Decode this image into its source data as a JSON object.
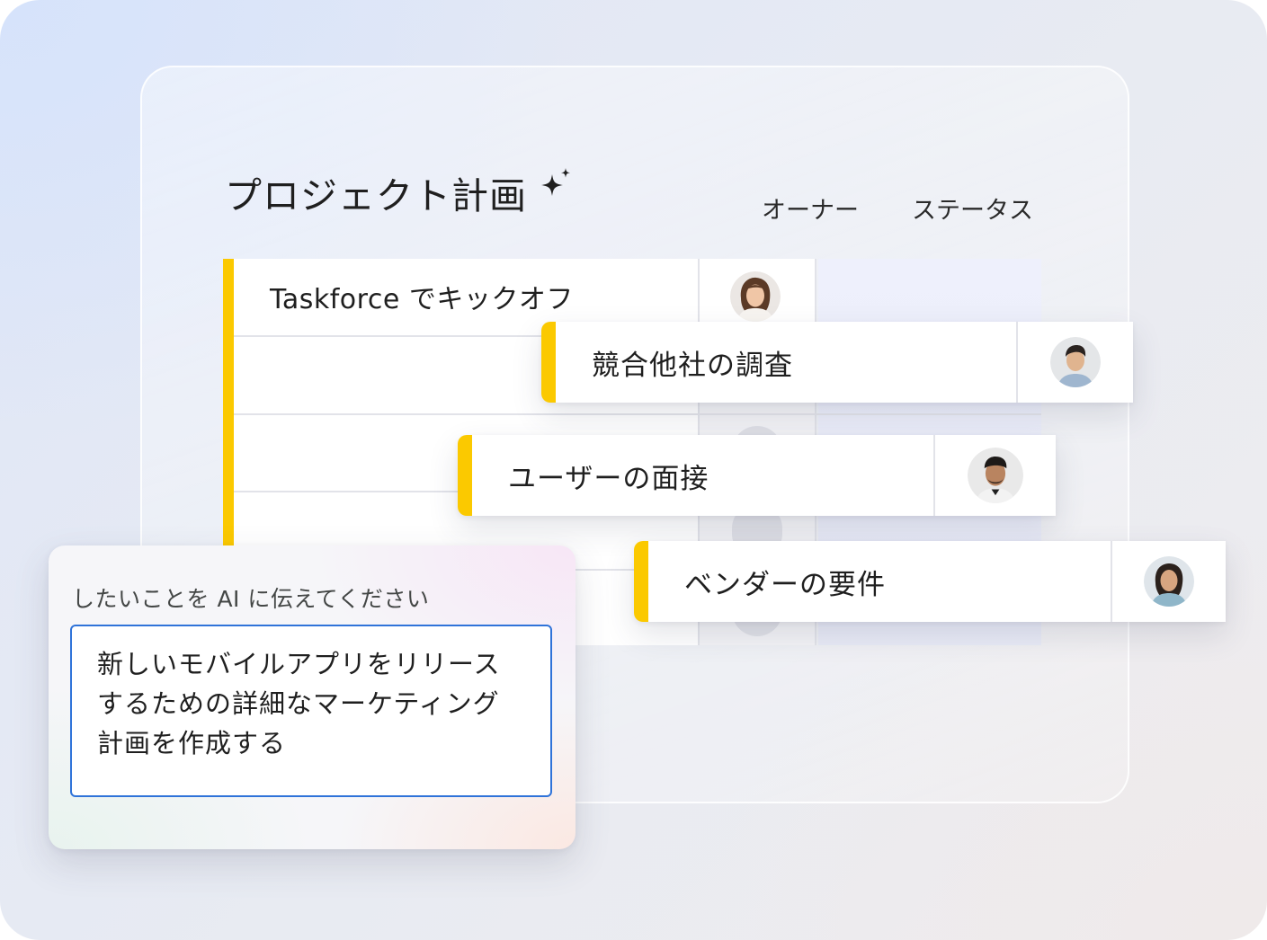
{
  "plan": {
    "title": "プロジェクト計画",
    "sparkle_icon": "sparkle-icon",
    "columns": {
      "owner": "オーナー",
      "status": "ステータス"
    }
  },
  "tasks": [
    {
      "label": "Taskforce でキックオフ",
      "avatar": "avatar-woman-1"
    },
    {
      "label": "競合他社の調査",
      "avatar": "avatar-man-1"
    },
    {
      "label": "ユーザーの面接",
      "avatar": "avatar-man-2"
    },
    {
      "label": "ベンダーの要件",
      "avatar": "avatar-woman-2"
    }
  ],
  "ai_prompt": {
    "label": "したいことを AI に伝えてください",
    "value": "新しいモバイルアプリをリリースするための詳細なマーケティング計画を作成する"
  },
  "colors": {
    "accent": "#fbc900",
    "input_border": "#2f73d9"
  }
}
